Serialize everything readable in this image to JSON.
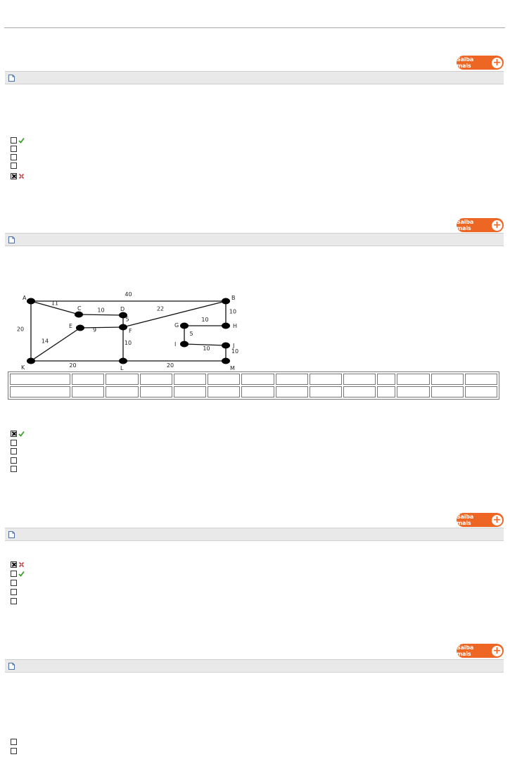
{
  "buttons": {
    "saiba_mais_label": "Saiba mais"
  },
  "questions": [
    {
      "answers": [
        {
          "checked": false,
          "mark": "correct"
        },
        {
          "checked": false,
          "mark": "none"
        },
        {
          "checked": false,
          "mark": "none"
        },
        {
          "checked": false,
          "mark": "none"
        },
        {
          "checked": true,
          "mark": "incorrect"
        }
      ]
    },
    {
      "graph": {
        "nodes": [
          "A",
          "B",
          "C",
          "D",
          "E",
          "F",
          "G",
          "H",
          "I",
          "J",
          "K",
          "L",
          "M"
        ],
        "edges": [
          {
            "from": "A",
            "to": "B",
            "weight": "40"
          },
          {
            "from": "A",
            "to": "C",
            "weight": "11"
          },
          {
            "from": "A",
            "to": "K",
            "weight": "20"
          },
          {
            "from": "C",
            "to": "D",
            "weight": "10"
          },
          {
            "from": "D",
            "to": "F",
            "weight": "5"
          },
          {
            "from": "F",
            "to": "B",
            "weight": "22"
          },
          {
            "from": "B",
            "to": "H",
            "weight": "10"
          },
          {
            "from": "E",
            "to": "F",
            "weight": "9"
          },
          {
            "from": "E",
            "to": "K",
            "weight": "14"
          },
          {
            "from": "F",
            "to": "L",
            "weight": "10"
          },
          {
            "from": "G",
            "to": "H",
            "weight": "10"
          },
          {
            "from": "G",
            "to": "I",
            "weight": "5"
          },
          {
            "from": "I",
            "to": "J",
            "weight": "10"
          },
          {
            "from": "J",
            "to": "M",
            "weight": "10"
          },
          {
            "from": "K",
            "to": "L",
            "weight": "20"
          },
          {
            "from": "L",
            "to": "M",
            "weight": "20"
          }
        ]
      },
      "table": {
        "rows": 2,
        "columns": 14
      },
      "answers": [
        {
          "checked": true,
          "mark": "correct"
        },
        {
          "checked": false,
          "mark": "none"
        },
        {
          "checked": false,
          "mark": "none"
        },
        {
          "checked": false,
          "mark": "none"
        },
        {
          "checked": false,
          "mark": "none"
        }
      ]
    },
    {
      "answers": [
        {
          "checked": true,
          "mark": "incorrect"
        },
        {
          "checked": false,
          "mark": "correct"
        },
        {
          "checked": false,
          "mark": "none"
        },
        {
          "checked": false,
          "mark": "none"
        },
        {
          "checked": false,
          "mark": "none"
        }
      ]
    },
    {
      "answers": [
        {
          "checked": false,
          "mark": "none"
        },
        {
          "checked": false,
          "mark": "none"
        }
      ]
    }
  ],
  "colors": {
    "button_orange": "#ee6624",
    "correct_green": "#3aa12a",
    "incorrect_red": "#d23a3a",
    "bar_gray": "#e9e9e9"
  }
}
